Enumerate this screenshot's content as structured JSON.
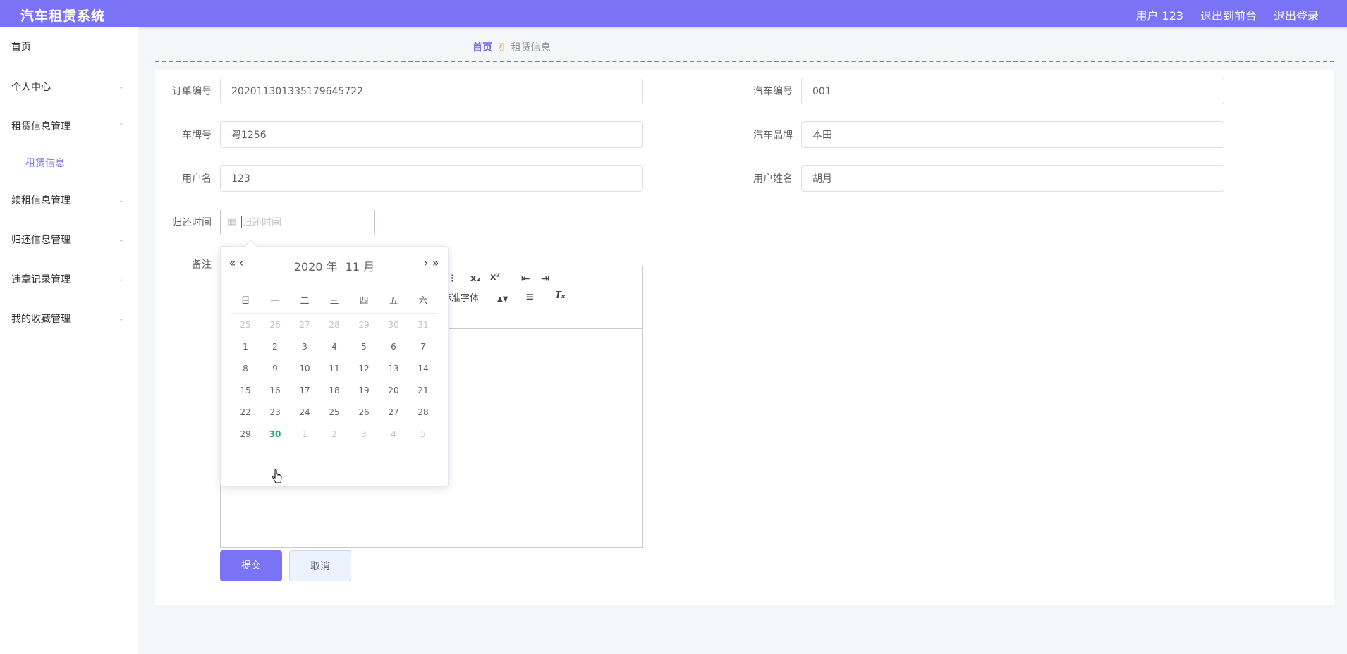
{
  "header": {
    "app_title": "汽车租赁系统",
    "user_label": "用户 123",
    "back_front": "退出到前台",
    "logout": "退出登录"
  },
  "sidebar": {
    "home": "首页",
    "personal": "个人中心",
    "rental_mgmt": "租赁信息管理",
    "rental_info": "租赁信息",
    "renewal_mgmt": "续租信息管理",
    "return_mgmt": "归还信息管理",
    "violation_mgmt": "违章记录管理",
    "favorites_mgmt": "我的收藏管理"
  },
  "breadcrumb": {
    "home": "首页",
    "separator": "✌",
    "current": "租赁信息"
  },
  "form": {
    "order_no_label": "订单编号",
    "order_no": "20201130133517964572​2",
    "car_no_label": "汽车编号",
    "car_no": "001",
    "plate_label": "车牌号",
    "plate": "粤1256",
    "brand_label": "汽车品牌",
    "brand": "本田",
    "username_label": "用户名",
    "username": "123",
    "realname_label": "用户姓名",
    "realname": "胡月",
    "return_time_label": "归还时间",
    "return_time_placeholder": "归还时间",
    "remark_label": "备注"
  },
  "editor": {
    "sub": "x₂",
    "sup": "x²",
    "font_select": "标准字体"
  },
  "buttons": {
    "submit": "提交",
    "cancel": "取消"
  },
  "datepicker": {
    "year_label": "2020 年",
    "month_label": "11 月",
    "weekdays": [
      "日",
      "一",
      "二",
      "三",
      "四",
      "五",
      "六"
    ],
    "weeks": [
      [
        "25",
        "26",
        "27",
        "28",
        "29",
        "30",
        "31"
      ],
      [
        "1",
        "2",
        "3",
        "4",
        "5",
        "6",
        "7"
      ],
      [
        "8",
        "9",
        "10",
        "11",
        "12",
        "13",
        "14"
      ],
      [
        "15",
        "16",
        "17",
        "18",
        "19",
        "20",
        "21"
      ],
      [
        "22",
        "23",
        "24",
        "25",
        "26",
        "27",
        "28"
      ],
      [
        "29",
        "30",
        "1",
        "2",
        "3",
        "4",
        "5"
      ]
    ],
    "today": "30",
    "accent_color": "#17a67a"
  },
  "colors": {
    "primary": "#7b73f5"
  }
}
